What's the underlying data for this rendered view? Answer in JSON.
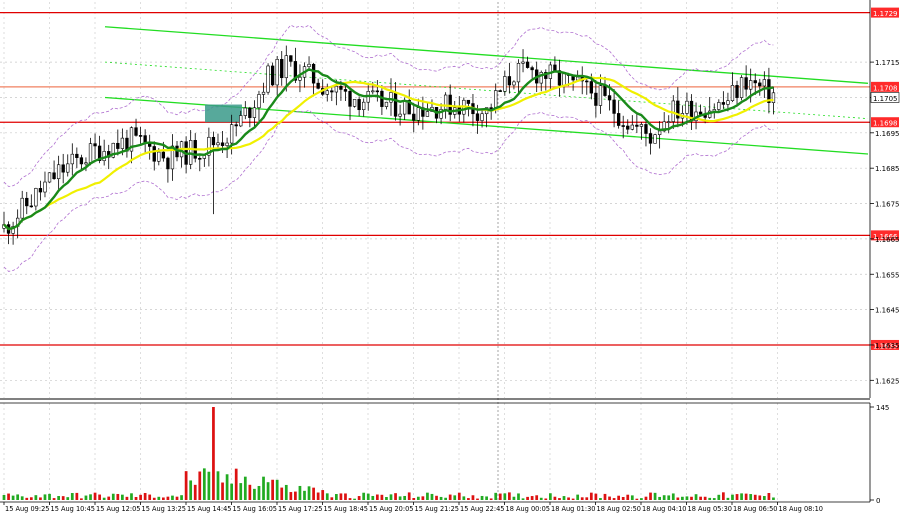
{
  "chart_data": [
    {
      "type": "candlestick",
      "instrument_price_axis": {
        "ylim": [
          1.162,
          1.1732
        ],
        "ticks": [
          "1.1715",
          "1.1705",
          "1.1695",
          "1.1685",
          "1.1675",
          "1.1665",
          "1.1655",
          "1.1645",
          "1.1635",
          "1.1625"
        ]
      },
      "levels": [
        {
          "value": 1.1729,
          "label": "1.1729",
          "color": "#e00000"
        },
        {
          "value": 1.1708,
          "label": "1.1708",
          "color": "#f08060"
        },
        {
          "value": 1.1698,
          "label": "1.1698",
          "color": "#e00000"
        },
        {
          "value": 1.1666,
          "label": "1.1666",
          "color": "#e00000"
        },
        {
          "value": 1.1635,
          "label": "1.1635",
          "color": "#e00000"
        }
      ],
      "current_price": {
        "value": 1.1705,
        "label": "1.1705"
      },
      "x_ticks": [
        "15 Aug 09:25",
        "15 Aug 10:45",
        "15 Aug 12:05",
        "15 Aug 13:25",
        "15 Aug 14:45",
        "15 Aug 16:05",
        "15 Aug 17:25",
        "15 Aug 18:45",
        "15 Aug 20:05",
        "15 Aug 21:25",
        "15 Aug 22:45",
        "18 Aug 00:05",
        "18 Aug 01:30",
        "18 Aug 02:50",
        "18 Aug 04:10",
        "18 Aug 05:30",
        "18 Aug 06:50",
        "18 Aug 08:10"
      ],
      "anchors": [
        [
          0,
          1.1668
        ],
        [
          6,
          1.1676
        ],
        [
          12,
          1.1684
        ],
        [
          20,
          1.169
        ],
        [
          28,
          1.1693
        ],
        [
          36,
          1.1688
        ],
        [
          44,
          1.1691
        ],
        [
          50,
          1.1695
        ],
        [
          54,
          1.1702
        ],
        [
          58,
          1.1711
        ],
        [
          62,
          1.1714
        ],
        [
          66,
          1.1712
        ],
        [
          72,
          1.1707
        ],
        [
          80,
          1.1704
        ],
        [
          90,
          1.1702
        ],
        [
          100,
          1.1703
        ],
        [
          106,
          1.1701
        ],
        [
          112,
          1.1712
        ],
        [
          118,
          1.1712
        ],
        [
          124,
          1.1709
        ],
        [
          130,
          1.1706
        ],
        [
          138,
          1.1697
        ],
        [
          142,
          1.1694
        ],
        [
          146,
          1.1701
        ],
        [
          152,
          1.1702
        ],
        [
          158,
          1.1703
        ],
        [
          163,
          1.171
        ],
        [
          168,
          1.1706
        ]
      ],
      "ma_fast": {
        "color": "#1a8a1a"
      },
      "ma_slow": {
        "color": "#f0f000"
      },
      "trend_channel": {
        "color": "#22dd22"
      },
      "entry_marker": {
        "color": "#3a9a8a"
      }
    },
    {
      "type": "bar",
      "title": "volume",
      "ylim": [
        0,
        145
      ],
      "ticks": [
        "145",
        "0"
      ],
      "spike": 145
    }
  ]
}
